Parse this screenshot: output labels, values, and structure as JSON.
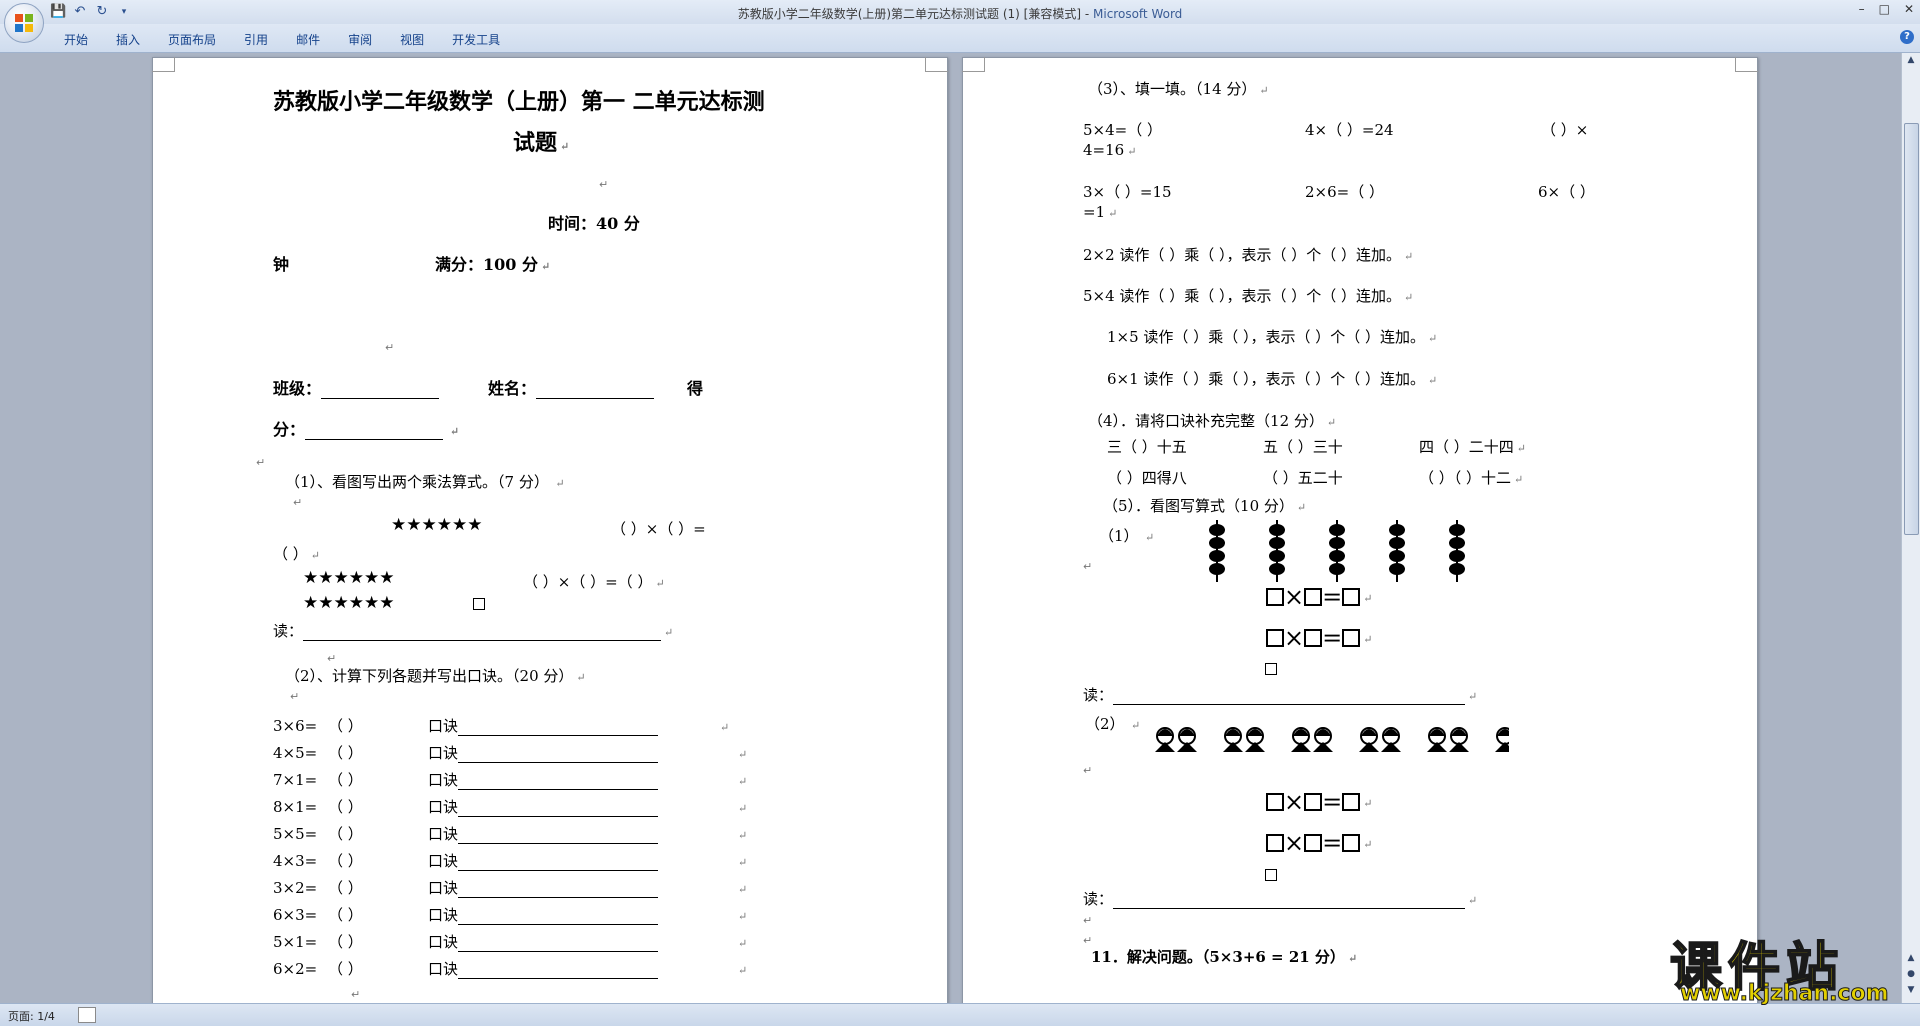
{
  "window": {
    "title": "苏教版小学二年级数学(上册)第二单元达标测试题 (1) [兼容模式]",
    "app_name": "Microsoft Word",
    "separator": " - "
  },
  "ribbon": {
    "tabs": [
      "开始",
      "插入",
      "页面布局",
      "引用",
      "邮件",
      "审阅",
      "视图",
      "开发工具"
    ]
  },
  "page1": {
    "title_line1": "苏教版小学二年级数学（上册）第一  二单元达标测",
    "title_line2": "试题",
    "time": "时间：40 分",
    "zhong": "钟",
    "full_score": "满分：100 分",
    "class_label": "班级：",
    "name_label": "姓名：",
    "de": "得",
    "fen": "分：",
    "q1_title": "（1）、看图写出两个乘法算式。（7 分）",
    "stars": "★★★★★★",
    "q1_eq_a": "（        ）×（        ）=",
    "q1_eq_a2": "（        ）",
    "q1_eq_b": "（        ）×（        ）=（        ）",
    "read_label": "读：",
    "q2_title": "（2）、计算下列各题并写出口诀。（20 分）",
    "koujue": "口诀",
    "paren": "（      ）",
    "q2_items": [
      "3×6=",
      "4×5=",
      "7×1=",
      "8×1=",
      "5×5=",
      "4×3=",
      "3×2=",
      "6×3=",
      "5×1=",
      "6×2="
    ]
  },
  "page2": {
    "q3_title": "（3）、填一填。（14 分）",
    "q3_r1": [
      "5×4=（        ）",
      "4×（        ）=24",
      "（        ）×"
    ],
    "q3_r1b": "4=16",
    "q3_r2": [
      "3×（        ）=15",
      "2×6=（        ）",
      "6×（        ）"
    ],
    "q3_r2b": "=1",
    "q3_read": [
      "2×2 读作（  ）乘（  ），表示（  ）个（  ）连加。",
      "5×4 读作（  ）乘（  ），表示（  ）个（  ）连加。",
      "1×5 读作（  ）乘（  ），表示（  ）个（  ）连加。",
      "6×1 读作（  ）乘（  ），表示（  ）个（  ）连加。"
    ],
    "q4_title": "（4）．请将口诀补充完整（12 分）",
    "q4_r1": [
      "三（  ）十五",
      "五（  ）三十",
      "四（  ）二十四"
    ],
    "q4_r2": [
      "（  ）四得八",
      "（  ）五二十",
      "（  ）（  ）十二"
    ],
    "q5_title": "（5）．看图写算式（10 分）",
    "q5_1": "（1）",
    "q5_2": "（2）",
    "times": "×",
    "eq": "=",
    "read_label": "读：",
    "q11": "11．解决问题。（5×3+6 = 21 分）"
  },
  "statusbar": {
    "page": "页面: 1/4"
  },
  "watermark": {
    "big": "课件站",
    "url": "www.kjzhan.com"
  }
}
